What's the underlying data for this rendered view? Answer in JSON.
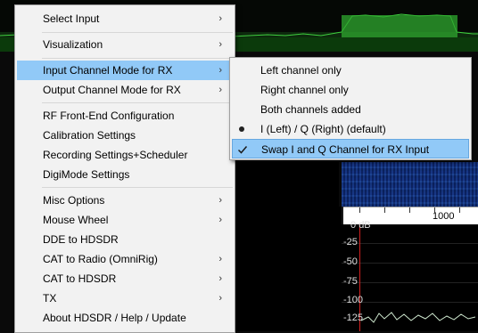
{
  "background": {
    "scale_label_1000": "1000",
    "db_labels": [
      "0",
      "-25",
      "-50",
      "-75",
      "-100",
      "-125"
    ],
    "db_unit": "dB"
  },
  "main_menu": {
    "items": [
      {
        "label": "Select Input",
        "submenu": true
      },
      {
        "label": "Visualization",
        "submenu": true
      },
      {
        "label": "Input Channel Mode for RX",
        "submenu": true
      },
      {
        "label": "Output Channel Mode for RX",
        "submenu": true
      },
      {
        "label": "RF Front-End Configuration",
        "submenu": false
      },
      {
        "label": "Calibration Settings",
        "submenu": false
      },
      {
        "label": "Recording Settings+Scheduler",
        "submenu": false
      },
      {
        "label": "DigiMode Settings",
        "submenu": false
      },
      {
        "label": "Misc Options",
        "submenu": true
      },
      {
        "label": "Mouse Wheel",
        "submenu": true
      },
      {
        "label": "DDE to HDSDR",
        "submenu": false
      },
      {
        "label": "CAT to Radio (OmniRig)",
        "submenu": true
      },
      {
        "label": "CAT to HDSDR",
        "submenu": true
      },
      {
        "label": "TX",
        "submenu": true
      },
      {
        "label": "About HDSDR / Help / Update",
        "submenu": false
      }
    ],
    "selected_index": 2,
    "arrow": "›"
  },
  "sub_menu": {
    "items": [
      {
        "label": "Left channel only",
        "mark": ""
      },
      {
        "label": "Right channel only",
        "mark": ""
      },
      {
        "label": "Both channels added",
        "mark": ""
      },
      {
        "label": "I (Left) / Q (Right)  (default)",
        "mark": "bullet"
      },
      {
        "label": "Swap I and Q Channel for RX Input",
        "mark": "check"
      }
    ],
    "selected_index": 4
  },
  "colors": {
    "highlight": "#91c9f7",
    "menu_bg": "#f2f2f2",
    "spectrum_green": "#2fa82f"
  }
}
